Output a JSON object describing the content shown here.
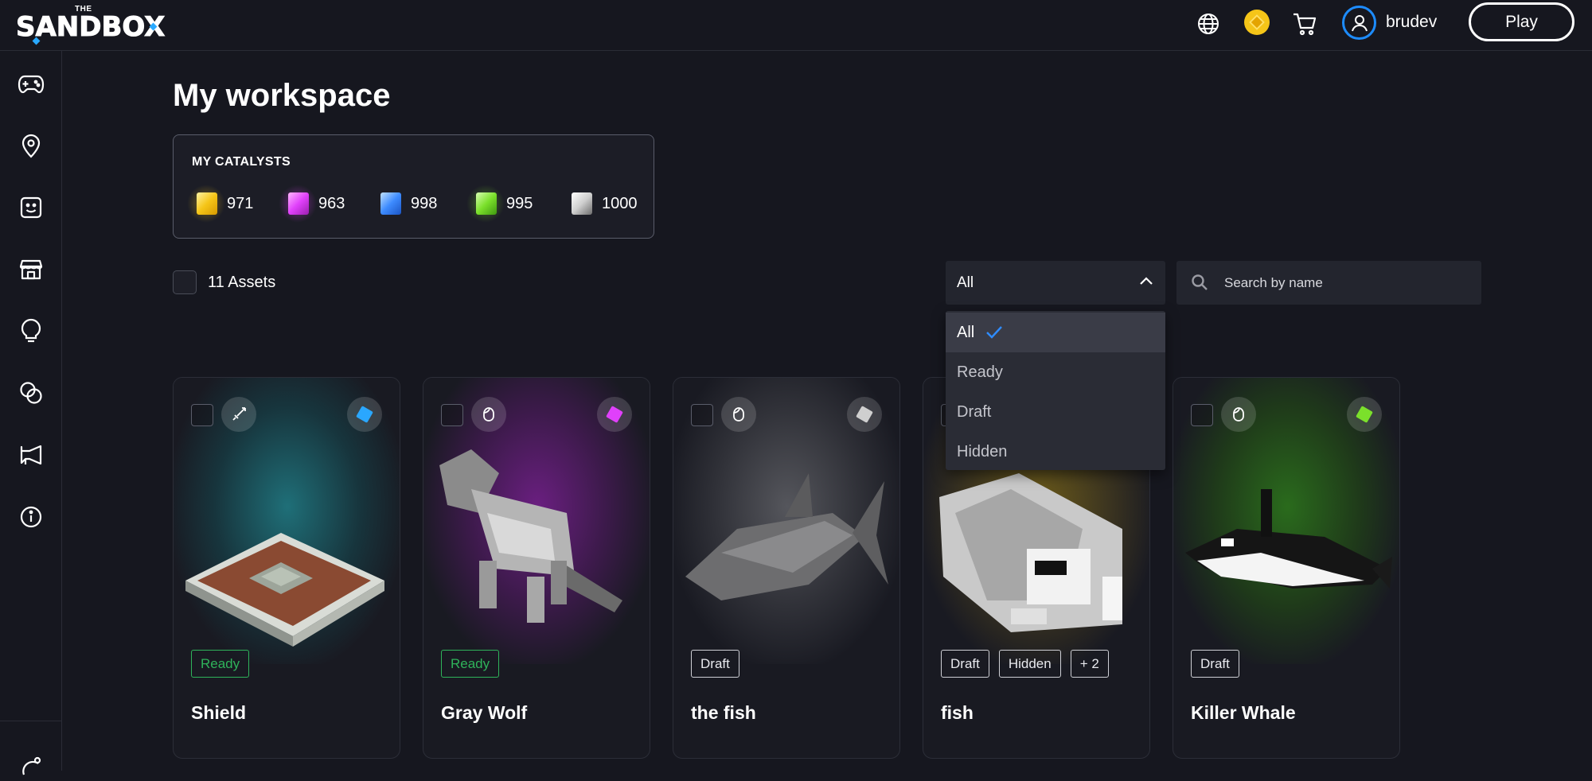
{
  "header": {
    "logo_the": "THE",
    "logo_word": "SANDBOX",
    "globe_icon": "globe-icon",
    "coin_icon": "sand-coin-icon",
    "cart_icon": "cart-icon",
    "user_icon": "user-icon",
    "username": "brudev",
    "play_label": "Play"
  },
  "sidebar": {
    "items": [
      {
        "name": "sidebar-item-games",
        "icon": "gamepad-icon"
      },
      {
        "name": "sidebar-item-map",
        "icon": "map-pin-icon"
      },
      {
        "name": "sidebar-item-avatar",
        "icon": "smiley-icon"
      },
      {
        "name": "sidebar-item-shop",
        "icon": "store-icon"
      },
      {
        "name": "sidebar-item-create",
        "icon": "lightbulb-icon"
      },
      {
        "name": "sidebar-item-community",
        "icon": "circles-icon"
      },
      {
        "name": "sidebar-item-news",
        "icon": "megaphone-icon"
      },
      {
        "name": "sidebar-item-info",
        "icon": "info-icon"
      }
    ]
  },
  "page": {
    "title": "My workspace"
  },
  "catalysts": {
    "label": "MY CATALYSTS",
    "items": [
      {
        "name": "legendary",
        "value": "971",
        "color": "#f5c518"
      },
      {
        "name": "epic",
        "value": "963",
        "color": "#e040fb"
      },
      {
        "name": "rare",
        "value": "998",
        "color": "#3d8bff"
      },
      {
        "name": "uncommon",
        "value": "995",
        "color": "#7be02b"
      },
      {
        "name": "common",
        "value": "1000",
        "color": "#cfcfcf"
      }
    ]
  },
  "assets": {
    "count_label": "11 Assets"
  },
  "filter": {
    "selected": "All",
    "options": [
      "All",
      "Ready",
      "Draft",
      "Hidden"
    ]
  },
  "search": {
    "placeholder": "Search by name"
  },
  "cards": [
    {
      "name": "Shield",
      "tags": [
        "Ready"
      ],
      "type_icon": "sword-icon",
      "rarity_color": "#2aa7ff",
      "bg": "#1f6f78"
    },
    {
      "name": "Gray Wolf",
      "tags": [
        "Ready"
      ],
      "type_icon": "avatar-head-icon",
      "rarity_color": "#e040fb",
      "bg": "#6a1f80"
    },
    {
      "name": "the fish",
      "tags": [
        "Draft"
      ],
      "type_icon": "avatar-head-icon",
      "rarity_color": "#cfcfcf",
      "bg": "#55565c"
    },
    {
      "name": "fish",
      "tags": [
        "Draft",
        "Hidden",
        "+ 2"
      ],
      "type_icon": "avatar-head-icon",
      "rarity_color": "#f5c518",
      "bg": "#6b5a1a"
    },
    {
      "name": "Killer Whale",
      "tags": [
        "Draft"
      ],
      "type_icon": "avatar-head-icon",
      "rarity_color": "#7be02b",
      "bg": "#2a6b1c"
    }
  ]
}
